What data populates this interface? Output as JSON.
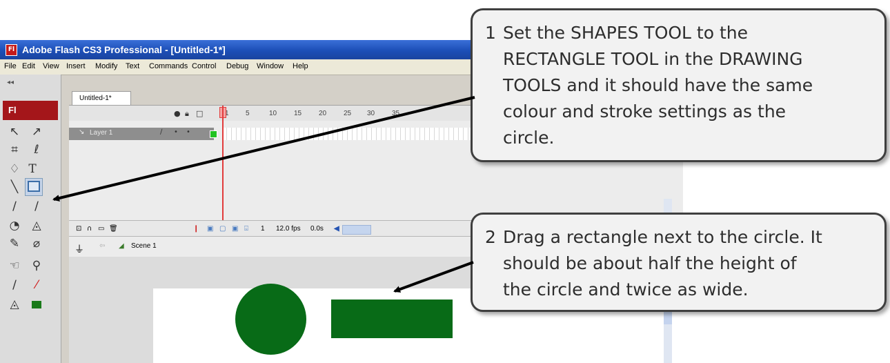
{
  "window": {
    "title": "Adobe Flash CS3 Professional - [Untitled-1*]",
    "app_icon": "Fl"
  },
  "menu": [
    "File",
    "Edit",
    "View",
    "Insert",
    "Modify",
    "Text",
    "Commands",
    "Control",
    "Debug",
    "Window",
    "Help"
  ],
  "tools_panel": {
    "collapse_glyph": "◂◂",
    "badge": "Fl"
  },
  "document_tab": "Untitled-1*",
  "timeline": {
    "frame_numbers": [
      "1",
      "5",
      "10",
      "15",
      "20",
      "25",
      "30",
      "35"
    ],
    "layer_name": "Layer 1",
    "status": {
      "current_frame": "1",
      "frame_rate": "12.0 fps",
      "elapsed": "0.0s"
    }
  },
  "edit_bar": {
    "scene": "Scene 1"
  },
  "colors": {
    "shape_fill": "#086b17",
    "callout_border": "#3f3f3f",
    "callout_bg": "#f2f2f2",
    "arrow": "#000000"
  },
  "callouts": [
    {
      "number": "1",
      "lines": [
        "Set the SHAPES TOOL to the",
        "RECTANGLE TOOL in the DRAWING",
        "TOOLS and it should have the same",
        "colour and stroke settings as the",
        "circle."
      ]
    },
    {
      "number": "2",
      "lines": [
        "Drag a rectangle next to the circle.  It",
        "should be about half the height of",
        "the circle and twice as wide."
      ]
    }
  ]
}
